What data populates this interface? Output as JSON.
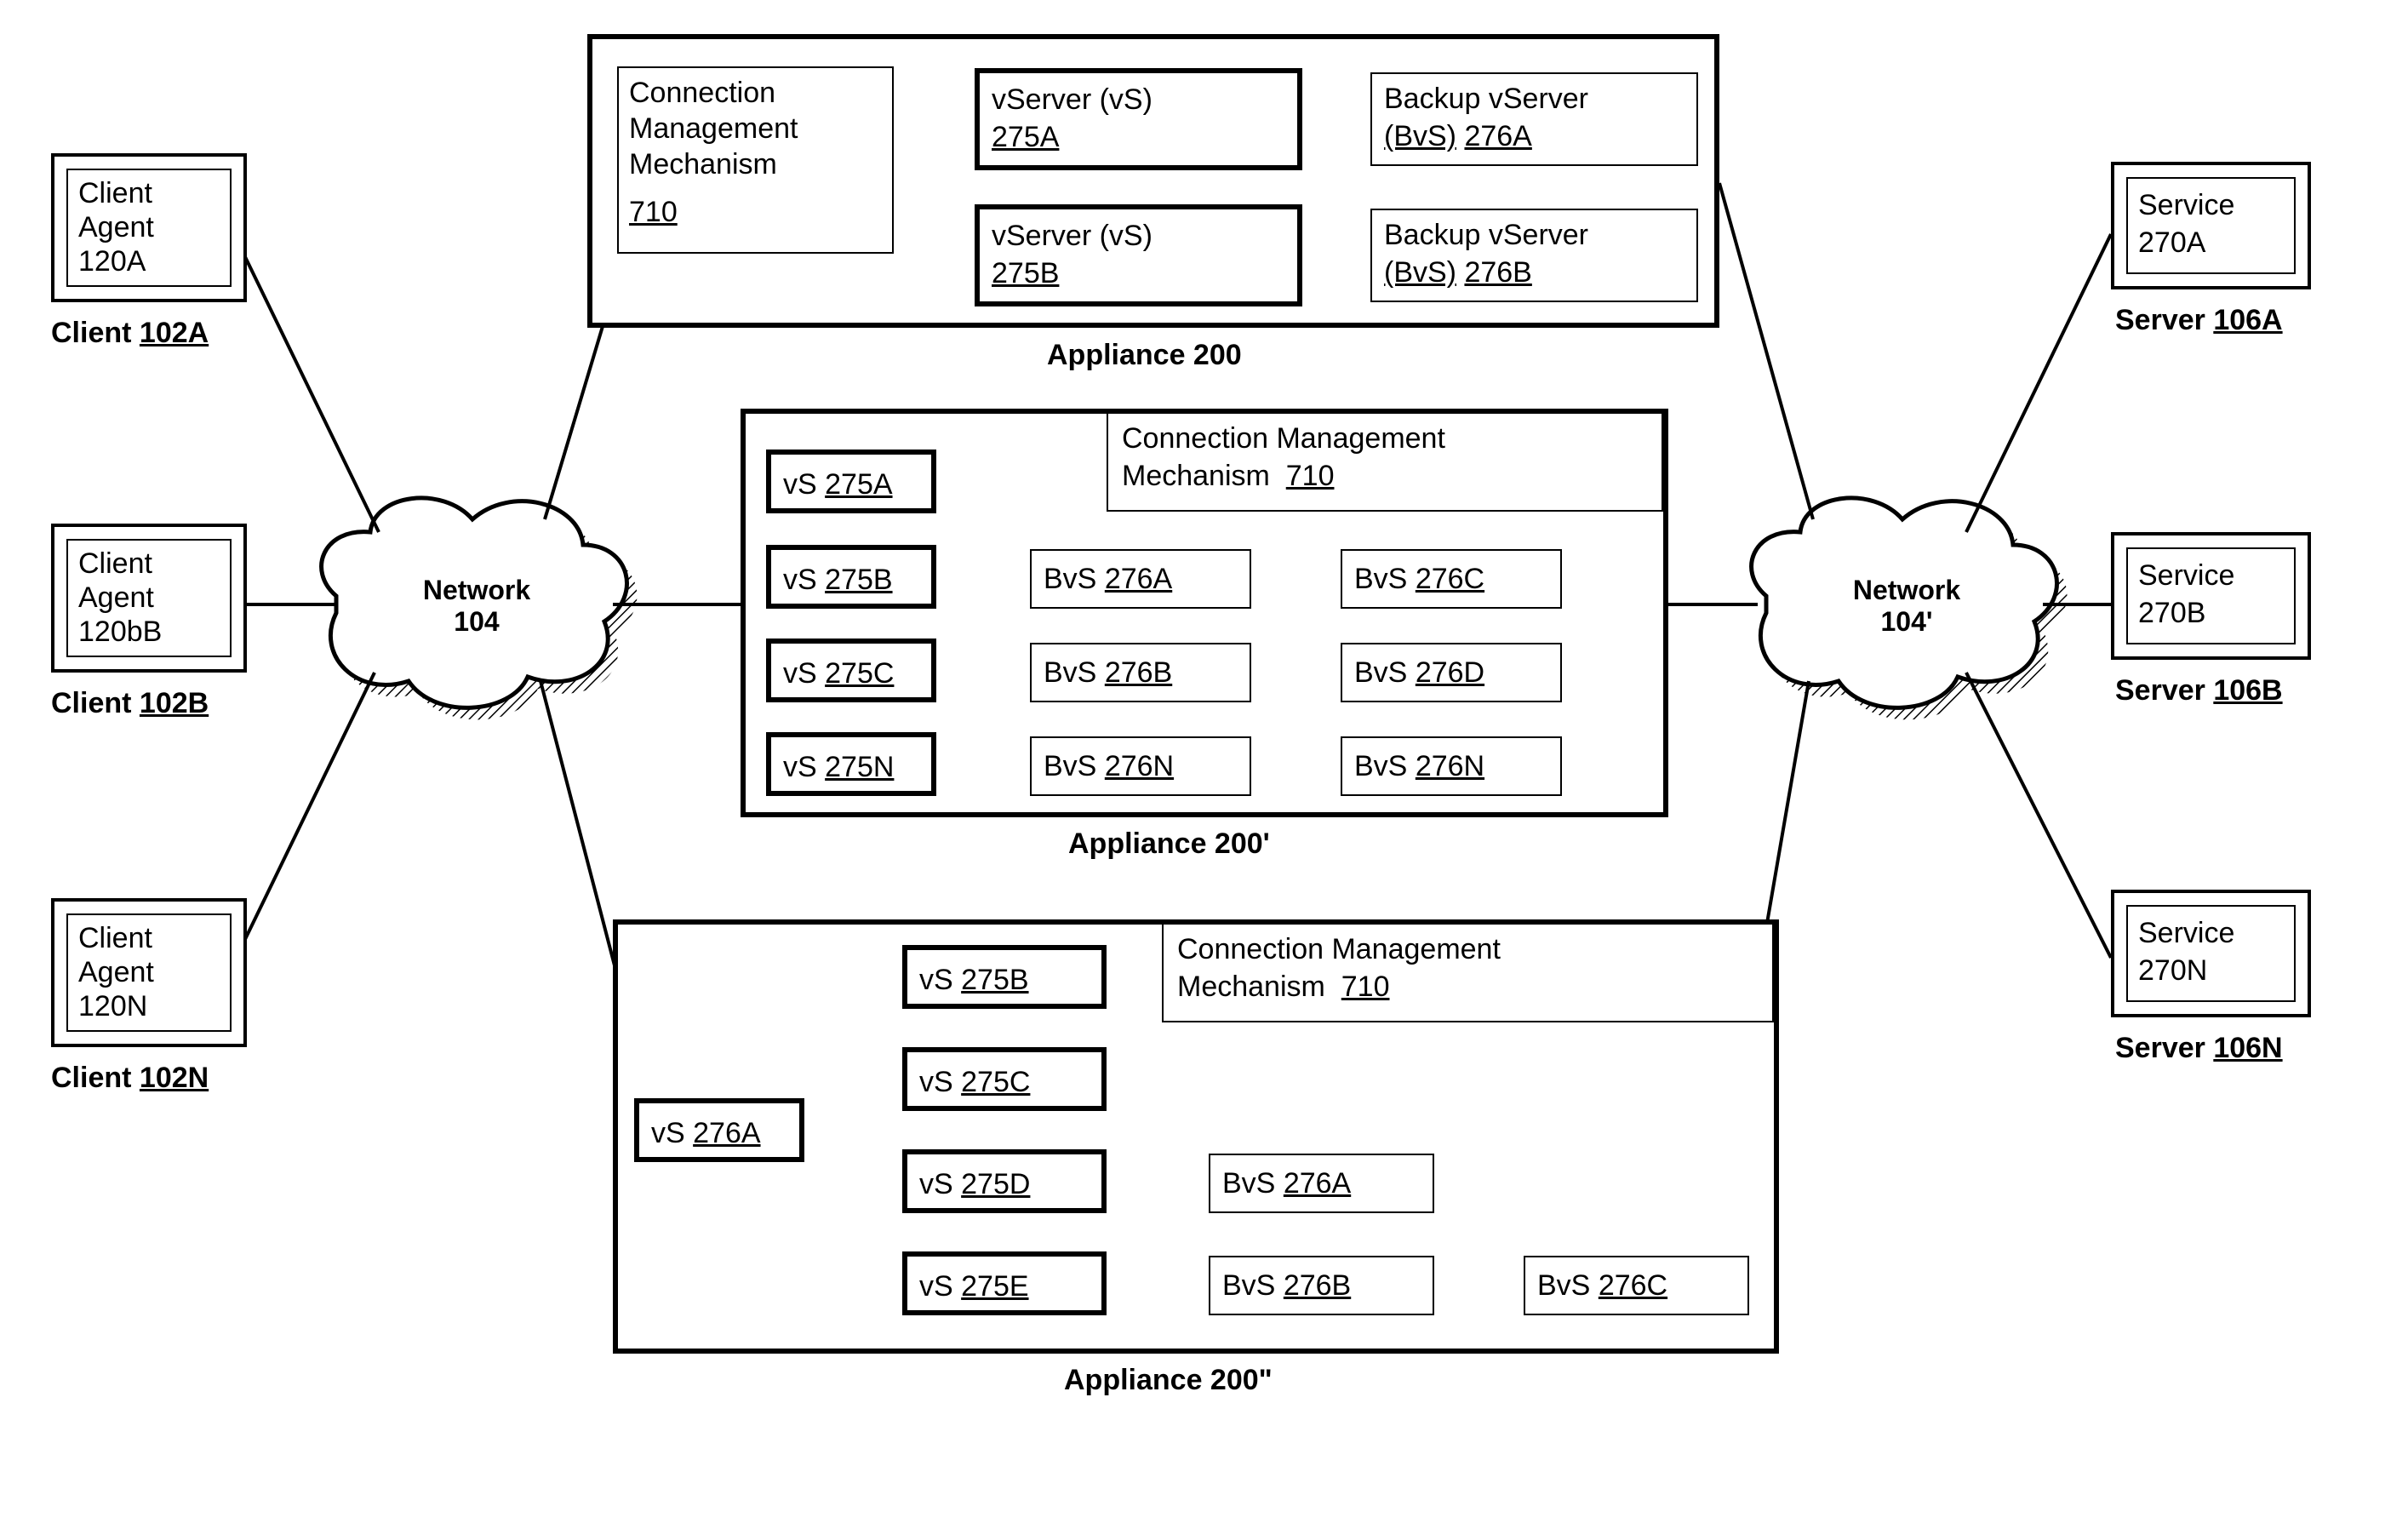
{
  "clients": [
    {
      "agentLine1": "Client",
      "agentLine2": "Agent",
      "agentId": "120A",
      "label": "Client",
      "labelId": "102A"
    },
    {
      "agentLine1": "Client",
      "agentLine2": "Agent",
      "agentId": "120bB",
      "label": "Client",
      "labelId": "102B"
    },
    {
      "agentLine1": "Client",
      "agentLine2": "Agent",
      "agentId": "120N",
      "label": "Client",
      "labelId": "102N"
    }
  ],
  "servers": [
    {
      "svcLine1": "Service",
      "svcId": "270A",
      "label": "Server",
      "labelId": "106A"
    },
    {
      "svcLine1": "Service",
      "svcId": "270B",
      "label": "Server",
      "labelId": "106B"
    },
    {
      "svcLine1": "Service",
      "svcId": "270N",
      "label": "Server",
      "labelId": "106N"
    }
  ],
  "networks": {
    "left": {
      "line1": "Network",
      "line2": "104"
    },
    "right": {
      "line1": "Network",
      "line2": "104'"
    }
  },
  "appliance200": {
    "caption": "Appliance 200",
    "cmm": {
      "l1": "Connection",
      "l2": "Management",
      "l3": "Mechanism",
      "id": "710"
    },
    "row1": {
      "vsLabel": "vServer (vS)",
      "vsId": "275A",
      "bvLabel": "Backup vServer",
      "bvId": "(BvS) 276A",
      "bvIdNum": "276A"
    },
    "row2": {
      "vsLabel": "vServer (vS)",
      "vsId": "275B",
      "bvLabel": "Backup vServer",
      "bvId": "(BvS) 276B",
      "bvIdNum": "276B"
    }
  },
  "appliance200p": {
    "caption": "Appliance 200'",
    "cmm": {
      "l1": "Connection Management",
      "l2": "Mechanism",
      "id": "710"
    },
    "vs": [
      {
        "pre": "vS",
        "id": "275A"
      },
      {
        "pre": "vS",
        "id": "275B"
      },
      {
        "pre": "vS",
        "id": "275C"
      },
      {
        "pre": "vS",
        "id": "275N"
      }
    ],
    "bvs1": [
      {
        "pre": "BvS",
        "id": "276A"
      },
      {
        "pre": "BvS",
        "id": "276B"
      },
      {
        "pre": "BvS",
        "id": "276N"
      }
    ],
    "bvs2": [
      {
        "pre": "BvS",
        "id": "276C"
      },
      {
        "pre": "BvS",
        "id": "276D"
      },
      {
        "pre": "BvS",
        "id": "276N"
      }
    ]
  },
  "appliance200pp": {
    "caption": "Appliance 200\"",
    "cmm": {
      "l1": "Connection Management",
      "l2": "Mechanism",
      "id": "710"
    },
    "left": {
      "pre": "vS",
      "id": "276A"
    },
    "vs": [
      {
        "pre": "vS",
        "id": "275B"
      },
      {
        "pre": "vS",
        "id": "275C"
      },
      {
        "pre": "vS",
        "id": "275D"
      },
      {
        "pre": "vS",
        "id": "275E"
      }
    ],
    "bvChain": [
      {
        "pre": "BvS",
        "id": "276A"
      },
      {
        "pre": "BvS",
        "id": "276B"
      },
      {
        "pre": "BvS",
        "id": "276C"
      }
    ]
  }
}
